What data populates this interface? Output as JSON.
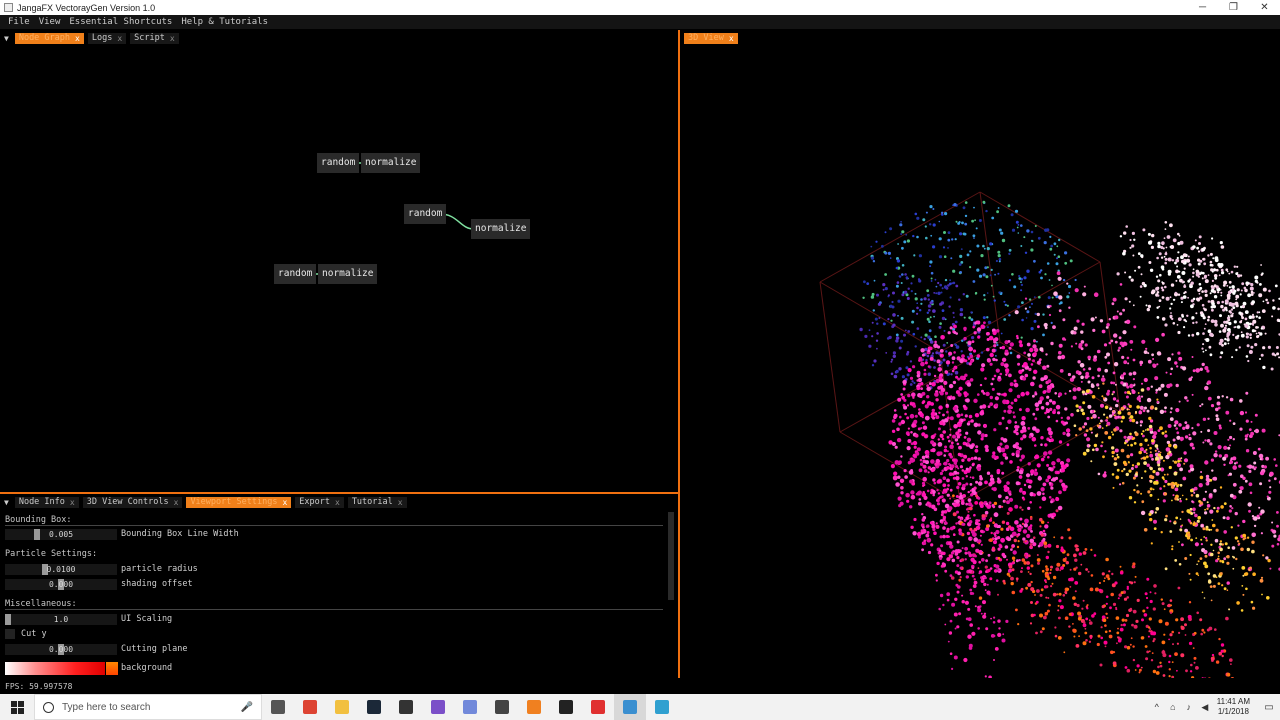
{
  "window": {
    "title": "JangaFX VectorayGen Version 1.0",
    "minimize": "─",
    "maximize": "❐",
    "close": "✕"
  },
  "menu": [
    "File",
    "View",
    "Essential Shortcuts",
    "Help & Tutorials"
  ],
  "top_tabs": [
    {
      "label": "Node Graph",
      "active": true
    },
    {
      "label": "Logs",
      "active": false
    },
    {
      "label": "Script",
      "active": false
    }
  ],
  "view_tab": {
    "label": "3D View"
  },
  "nodes": [
    {
      "label": "random"
    },
    {
      "label": "normalize"
    },
    {
      "label": "random"
    },
    {
      "label": "normalize"
    },
    {
      "label": "random"
    },
    {
      "label": "normalize"
    }
  ],
  "bottom_tabs": [
    {
      "label": "Node Info",
      "active": false
    },
    {
      "label": "3D View Controls",
      "active": false
    },
    {
      "label": "Viewport Settings",
      "active": true
    },
    {
      "label": "Export",
      "active": false
    },
    {
      "label": "Tutorial",
      "active": false
    }
  ],
  "settings": {
    "bounding_box": {
      "header": "Bounding Box:",
      "line_width_value": "0.005",
      "line_width_label": "Bounding Box Line Width",
      "line_width_level": 0.27
    },
    "particle": {
      "header": "Particle Settings:",
      "radius_value": "0.0100",
      "radius_label": "particle radius",
      "radius_level": 0.35,
      "shading_value": "0.000",
      "shading_label": "shading offset",
      "shading_level": 0.5
    },
    "misc": {
      "header": "Miscellaneous:",
      "ui_scaling_value": "1.0",
      "ui_scaling_label": "UI Scaling",
      "ui_scaling_level": 0.0,
      "cut_y_label": "Cut y",
      "cutting_value": "0.000",
      "cutting_label": "Cutting plane",
      "cutting_level": 0.5,
      "background_label": "background"
    }
  },
  "status": {
    "fps": "FPS: 59.997578"
  },
  "taskbar": {
    "search_placeholder": "Type here to search",
    "time": "11:41 AM",
    "date": "1/1/2018",
    "apps": [
      {
        "icon": "task-view-icon",
        "color": "#555555"
      },
      {
        "icon": "chrome-icon",
        "color": "#dd4433"
      },
      {
        "icon": "file-explorer-icon",
        "color": "#f2c040"
      },
      {
        "icon": "steam-icon",
        "color": "#1b2838"
      },
      {
        "icon": "epic-games-icon",
        "color": "#333333"
      },
      {
        "icon": "app-purple-icon",
        "color": "#7b4fc8"
      },
      {
        "icon": "discord-icon",
        "color": "#7289da"
      },
      {
        "icon": "app-dark-icon",
        "color": "#444444"
      },
      {
        "icon": "sublime-icon",
        "color": "#f08020"
      },
      {
        "icon": "terminal-icon",
        "color": "#222222"
      },
      {
        "icon": "app-red-icon",
        "color": "#e03030"
      },
      {
        "icon": "vectoraygen-icon",
        "color": "#3a8fd0"
      },
      {
        "icon": "app-blue-icon",
        "color": "#30a0d0"
      }
    ]
  },
  "accent": "#f07010"
}
